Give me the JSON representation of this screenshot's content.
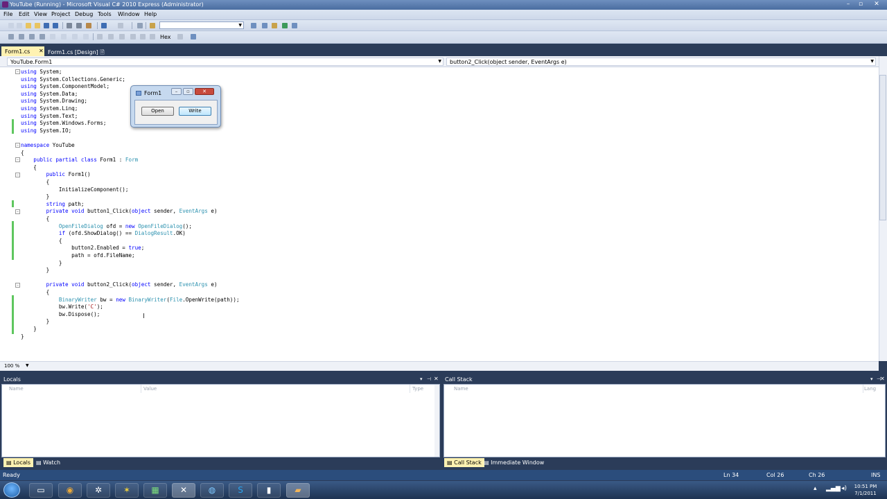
{
  "window": {
    "title": "YouTube (Running) - Microsoft Visual C# 2010 Express (Administrator)"
  },
  "menu": [
    "File",
    "Edit",
    "View",
    "Project",
    "Debug",
    "Tools",
    "Window",
    "Help"
  ],
  "toolbar2": {
    "hex_label": "Hex"
  },
  "tabs": [
    {
      "label": "Form1.cs",
      "pin": "⊠",
      "close": "✕"
    },
    {
      "label": "Form1.cs [Design]",
      "pin": "🗎"
    }
  ],
  "nav": {
    "class_combo": "YouTube.Form1",
    "member_combo": "button2_Click(object sender, EventArgs e)"
  },
  "code": [
    "using System;",
    "using System.Collections.Generic;",
    "using System.ComponentModel;",
    "using System.Data;",
    "using System.Drawing;",
    "using System.Linq;",
    "using System.Text;",
    "using System.Windows.Forms;",
    "using System.IO;",
    "",
    "namespace YouTube",
    "{",
    "    public partial class Form1 : Form",
    "    {",
    "        public Form1()",
    "        {",
    "            InitializeComponent();",
    "        }",
    "        string path;",
    "        private void button1_Click(object sender, EventArgs e)",
    "        {",
    "            OpenFileDialog ofd = new OpenFileDialog();",
    "            if (ofd.ShowDialog() == DialogResult.OK)",
    "            {",
    "                button2.Enabled = true;",
    "                path = ofd.FileName;",
    "            }",
    "        }",
    "",
    "        private void button2_Click(object sender, EventArgs e)",
    "        {",
    "            BinaryWriter bw = new BinaryWriter(File.OpenWrite(path));",
    "            bw.Write('C');",
    "            bw.Dispose();",
    "        }",
    "    }",
    "}"
  ],
  "zoom": "100 %",
  "form1": {
    "title": "Form1",
    "open_label": "Open",
    "write_label": "Write"
  },
  "locals": {
    "title": "Locals",
    "columns": [
      "Name",
      "Value",
      "Type"
    ]
  },
  "callstack": {
    "title": "Call Stack",
    "columns": [
      "Name",
      "Lang"
    ]
  },
  "bottom_tabs_left": [
    "Locals",
    "Watch"
  ],
  "bottom_tabs_right": [
    "Call Stack",
    "Immediate Window"
  ],
  "status": {
    "text": "Ready",
    "ln": "Ln 34",
    "col": "Col 26",
    "ch": "Ch 26",
    "mode": "INS"
  },
  "clock": {
    "time": "10:51 PM",
    "date": "7/1/2011"
  },
  "colors": {
    "title_bar": "#4a6da0",
    "ide_frame": "#2b3c59",
    "active_tab": "#fff2b2",
    "status_bar": "#2b4d7c",
    "keyword": "#0000ff",
    "type": "#2b91af"
  }
}
